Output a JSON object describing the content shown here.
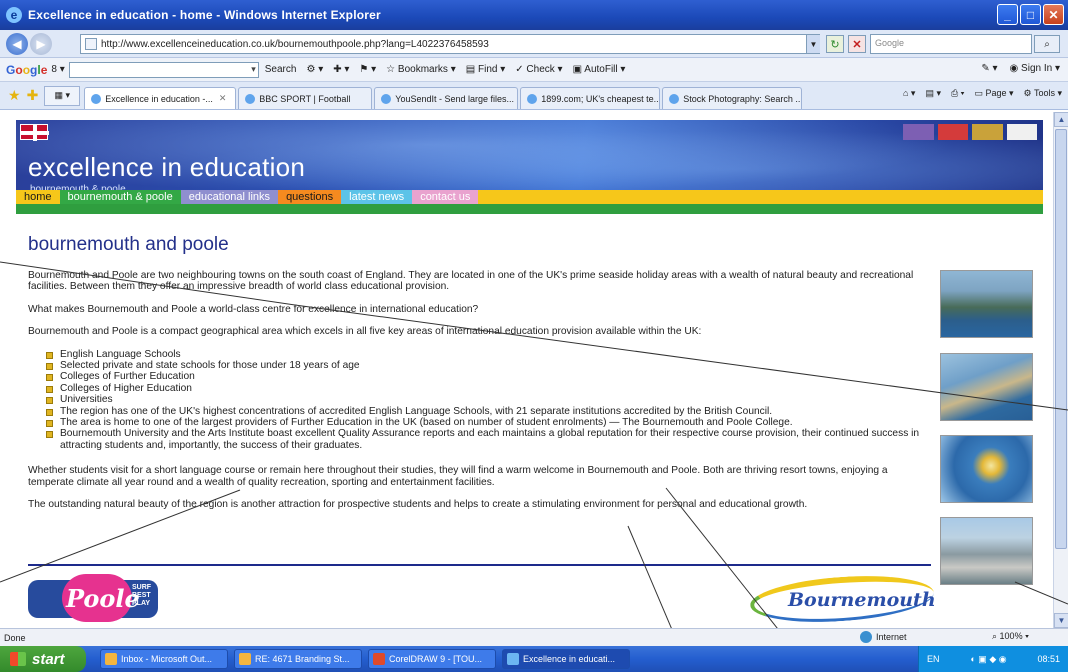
{
  "window": {
    "title": "Excellence in education - home - Windows Internet Explorer",
    "buttons": [
      "_",
      "□",
      "✕"
    ]
  },
  "addressbar": {
    "url": "http://www.excellenceineducation.co.uk/bournemouthpoole.php?lang=L4022376458593",
    "search_placeholder": "Google"
  },
  "google_toolbar": {
    "search_label": "Search",
    "bookmarks": "Bookmarks",
    "find": "Find",
    "check": "Check",
    "autofill": "AutoFill",
    "sign_in": "Sign In"
  },
  "tabs": [
    {
      "label": "Excellence in education -...",
      "active": true
    },
    {
      "label": "BBC SPORT | Football",
      "active": false
    },
    {
      "label": "YouSendIt - Send large files...",
      "active": false
    },
    {
      "label": "1899.com; UK's cheapest te...",
      "active": false
    },
    {
      "label": "Stock Photography: Search ...",
      "active": false
    }
  ],
  "command_bar": {
    "page": "Page",
    "tools": "Tools"
  },
  "site": {
    "title": "excellence in education",
    "subtitle": "bournemouth & poole",
    "nav": [
      "home",
      "bournemouth & poole",
      "educational links",
      "questions",
      "latest news",
      "contact us"
    ],
    "heading": "bournemouth and poole",
    "para1": "Bournemouth and Poole are two neighbouring towns on the south coast of England. They are located in one of the UK's prime seaside holiday areas with a wealth of natural beauty and recreational facilities. Between them they offer an impressive breadth of world class educational provision.",
    "para2": "What makes Bournemouth and Poole a world-class centre for excellence in international education?",
    "para3": "Bournemouth and Poole is a compact geographical area which excels in all five key areas of international education provision available within the UK:",
    "list": [
      "English Language Schools",
      "Selected private and state schools for those under 18 years of age",
      "Colleges of Further Education",
      "Colleges of Higher Education",
      "Universities",
      "The region has one of the UK's highest concentrations of accredited English Language Schools, with 21 separate institutions accredited by the British Council.",
      "The area is home to one of the largest providers of Further Education in the UK (based on number of student enrolments) — The Bournemouth and Poole College.",
      "Bournemouth University and the Arts Institute boast excellent Quality Assurance reports and each maintains a global reputation for their respective course provision, their continued success in attracting students and, importantly, the success of their graduates."
    ],
    "para4": "Whether students visit for a short language course or remain here throughout their studies, they will find a warm welcome in Bournemouth and Poole. Both are thriving resort towns, enjoying a temperate climate all year round and a wealth of quality recreation, sporting and entertainment facilities.",
    "para5": "The outstanding natural beauty of the region is another attraction for prospective students and helps to create a stimulating environment for personal and educational growth.",
    "poole_logo_text": "Poole",
    "poole_tagline": "SURF BEST PLAY",
    "bournemouth_logo_text": "Bournemouth"
  },
  "statusbar": {
    "status": "Done",
    "zone": "Internet",
    "zoom": "100%"
  },
  "taskbar": {
    "start": "start",
    "tasks": [
      {
        "label": "Inbox - Microsoft Out...",
        "active": false
      },
      {
        "label": "RE: 4671 Branding St...",
        "active": false
      },
      {
        "label": "CorelDRAW 9 - [TOU...",
        "active": false
      },
      {
        "label": "Excellence in educati...",
        "active": true
      }
    ],
    "lang": "EN",
    "clock": "08:51"
  }
}
